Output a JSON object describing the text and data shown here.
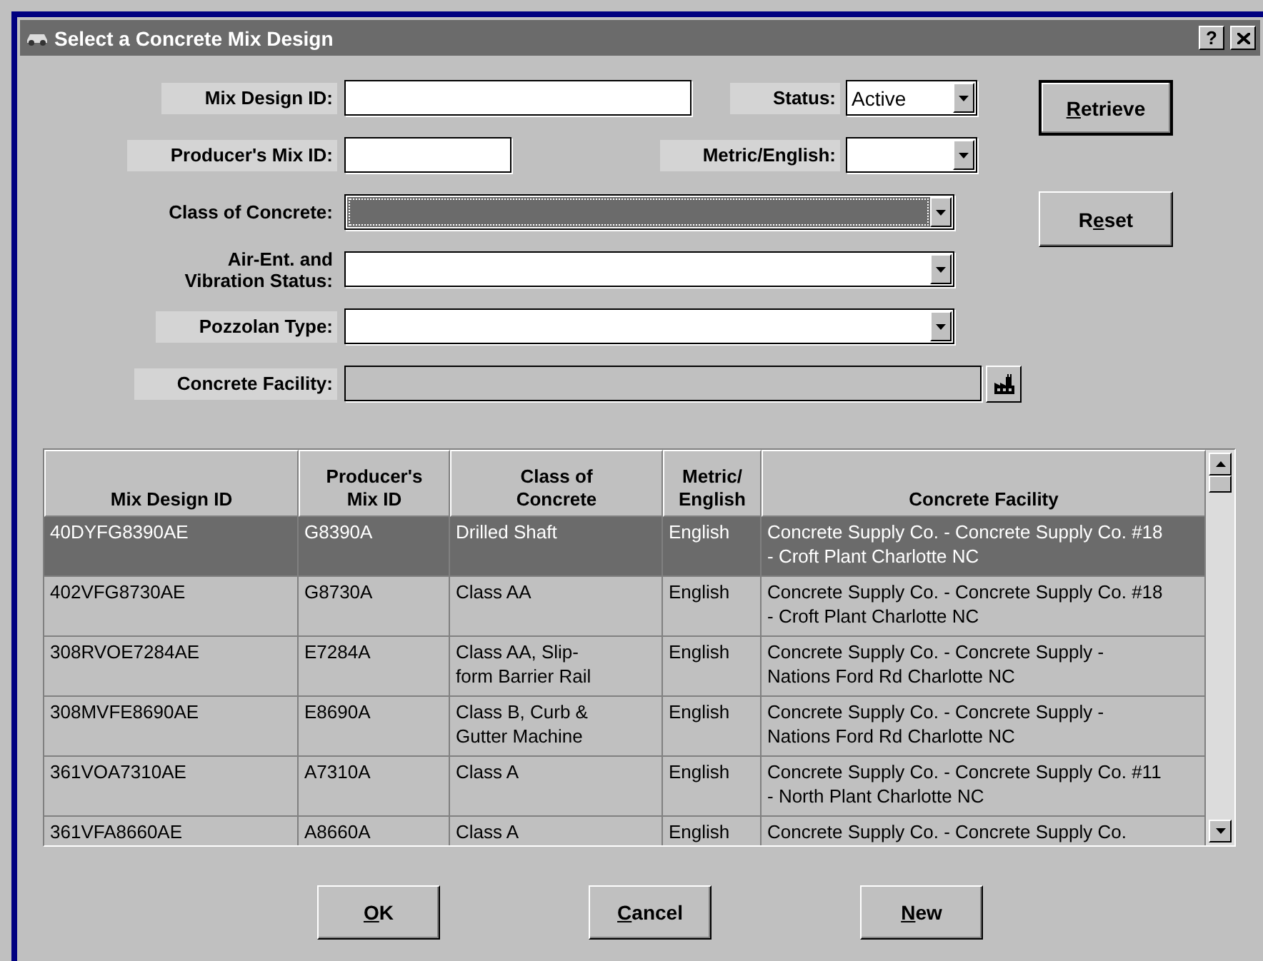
{
  "window": {
    "title": "Select a Concrete Mix Design",
    "help_button": "?"
  },
  "fields": [
    {
      "kind": "text",
      "label": [
        "Mix Design ID:"
      ],
      "shaded": true,
      "side": {
        "label": "Status:",
        "kind": "select",
        "value": "Active"
      }
    },
    {
      "kind": "text",
      "label": [
        "Producer's Mix ID:"
      ],
      "shaded": true,
      "side": {
        "label": "Metric/English:",
        "kind": "select"
      }
    },
    {
      "kind": "select",
      "label": [
        "Class of Concrete:"
      ],
      "shaded": false,
      "focused": true
    },
    {
      "kind": "select",
      "label": [
        "Air-Ent. and",
        "Vibration Status:"
      ],
      "shaded": false,
      "focused": false
    },
    {
      "kind": "select",
      "label": [
        "Pozzolan Type:"
      ],
      "shaded": true,
      "focused": false
    },
    {
      "kind": "lookup",
      "label": [
        "Concrete Facility:"
      ],
      "shaded": true
    }
  ],
  "side_buttons": [
    {
      "key": "R",
      "suffix": "etrieve",
      "default": true
    },
    {
      "prefix": "R",
      "key": "e",
      "suffix": "set",
      "default": false
    }
  ],
  "table": {
    "columns": [
      "Mix Design ID",
      "Producer's\nMix ID",
      "Class of\nConcrete",
      "Metric/\nEnglish",
      "Concrete Facility"
    ],
    "rows": [
      {
        "selected": true,
        "cells": [
          "40DYFG8390AE",
          "G8390A",
          "Drilled Shaft",
          "English",
          "Concrete Supply Co. - Concrete Supply Co. #18 - Croft Plant Charlotte NC"
        ]
      },
      {
        "selected": false,
        "cells": [
          "402VFG8730AE",
          "G8730A",
          "Class AA",
          "English",
          "Concrete Supply Co. - Concrete Supply Co. #18 - Croft Plant Charlotte NC"
        ]
      },
      {
        "selected": false,
        "cells": [
          "308RVOE7284AE",
          "E7284A",
          "Class AA, Slip-form Barrier Rail",
          "English",
          "Concrete Supply Co. - Concrete Supply - Nations Ford Rd Charlotte NC"
        ]
      },
      {
        "selected": false,
        "cells": [
          "308MVFE8690AE",
          "E8690A",
          "Class B, Curb & Gutter Machine",
          "English",
          "Concrete Supply Co. - Concrete Supply - Nations Ford Rd Charlotte NC"
        ]
      },
      {
        "selected": false,
        "cells": [
          "361VOA7310AE",
          "A7310A",
          "Class A",
          "English",
          "Concrete Supply Co. - Concrete Supply Co. #11 - North Plant Charlotte NC"
        ]
      },
      {
        "selected": false,
        "cells": [
          "361VFA8660AE",
          "A8660A",
          "Class A",
          "English",
          "Concrete Supply Co. - Concrete Supply Co."
        ]
      }
    ]
  },
  "buttons": [
    {
      "key": "O",
      "suffix": "K"
    },
    {
      "key": "C",
      "suffix": "ancel"
    },
    {
      "key": "N",
      "suffix": "ew"
    }
  ]
}
